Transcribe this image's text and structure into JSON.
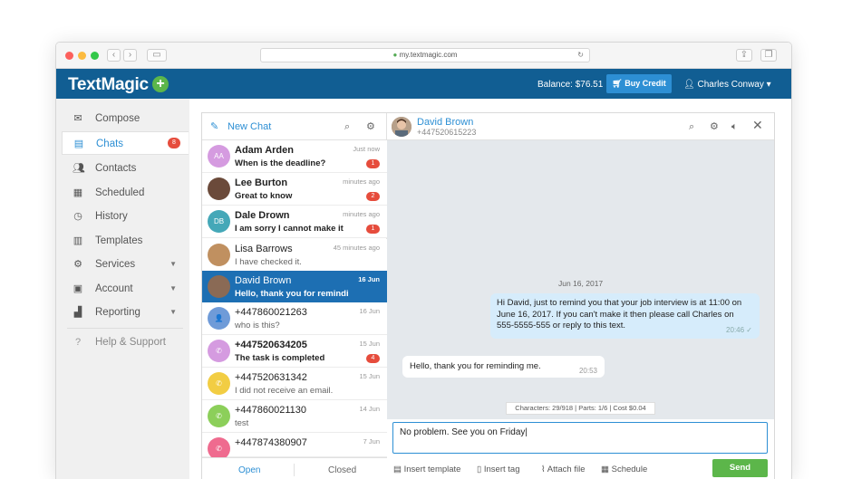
{
  "browser": {
    "url": "my.textmagic.com"
  },
  "header": {
    "logo": "TextMagic",
    "plus": "+",
    "balance": "Balance: $76.51",
    "buy_credit": "Buy Credit",
    "user": "Charles Conway ▾"
  },
  "sidebar": {
    "items": [
      {
        "label": "Compose",
        "icon": "compose-icon"
      },
      {
        "label": "Chats",
        "icon": "chat-icon",
        "badge": "8"
      },
      {
        "label": "Contacts",
        "icon": "contacts-icon"
      },
      {
        "label": "Scheduled",
        "icon": "calendar-icon"
      },
      {
        "label": "History",
        "icon": "history-icon"
      },
      {
        "label": "Templates",
        "icon": "clipboard-icon"
      },
      {
        "label": "Services",
        "icon": "services-icon"
      },
      {
        "label": "Account",
        "icon": "account-icon"
      },
      {
        "label": "Reporting",
        "icon": "chart-icon"
      },
      {
        "label": "Help & Support",
        "icon": "help-icon"
      }
    ]
  },
  "chat_list": {
    "new_chat": "New Chat",
    "rows": [
      {
        "name": "Adam Arden",
        "preview": "When is the deadline?",
        "time": "Just now",
        "badge": "1",
        "initials": "AA",
        "color": "#d59be0",
        "bold": true
      },
      {
        "name": "Lee Burton",
        "preview": "Great to know",
        "time": "minutes ago",
        "badge": "2",
        "initials": "",
        "color": "#6b4a3a",
        "bold": true
      },
      {
        "name": "Dale Drown",
        "preview": "I am sorry I cannot make it",
        "time": "minutes ago",
        "badge": "1",
        "initials": "DB",
        "color": "#45a8b8",
        "bold": true
      },
      {
        "name": "Lisa Barrows",
        "preview": "I have checked it.",
        "time": "45 minutes ago",
        "badge": "",
        "initials": "",
        "color": "#c09060",
        "bold": false
      },
      {
        "name": "David Brown",
        "preview": "Hello, thank you for remindin...",
        "time": "16 Jun",
        "badge": "",
        "initials": "",
        "color": "#8a6a55",
        "bold": false
      },
      {
        "name": "+447860021263",
        "preview": "who is this?",
        "time": "16 Jun",
        "badge": "",
        "initials": "👤",
        "color": "#6f9bd8",
        "bold": false
      },
      {
        "name": "+447520634205",
        "preview": "The task is completed",
        "time": "15 Jun",
        "badge": "4",
        "initials": "✆",
        "color": "#d59be0",
        "bold": true
      },
      {
        "name": "+447520631342",
        "preview": "I did not receive an email.",
        "time": "15 Jun",
        "badge": "",
        "initials": "✆",
        "color": "#f2cd43",
        "bold": false
      },
      {
        "name": "+447860021130",
        "preview": "test",
        "time": "14 Jun",
        "badge": "",
        "initials": "✆",
        "color": "#8ccf5a",
        "bold": false
      },
      {
        "name": "+447874380907",
        "preview": "",
        "time": "7 Jun",
        "badge": "",
        "initials": "✆",
        "color": "#ef6b8f",
        "bold": false
      }
    ],
    "footer": {
      "open": "Open",
      "closed": "Closed"
    }
  },
  "conversation": {
    "name": "David Brown",
    "phone": "+447520615223",
    "date": "Jun 16, 2017",
    "outgoing": {
      "text": "Hi David, just to remind you that your job interview is at 11:00 on June 16, 2017. If you can't make it then please call Charles on 555-5555-555 or reply to this text.",
      "time": "20:46 ✓"
    },
    "incoming": {
      "text": "Hello, thank you for reminding me.",
      "time": "20:53"
    },
    "counter": "Characters: 29/918 | Parts: 1/6 | Cost $0.04",
    "input": "No problem. See you on Friday|",
    "tools": {
      "template": "Insert template",
      "tag": "Insert tag",
      "attach": "Attach file",
      "schedule": "Schedule",
      "send": "Send"
    }
  }
}
